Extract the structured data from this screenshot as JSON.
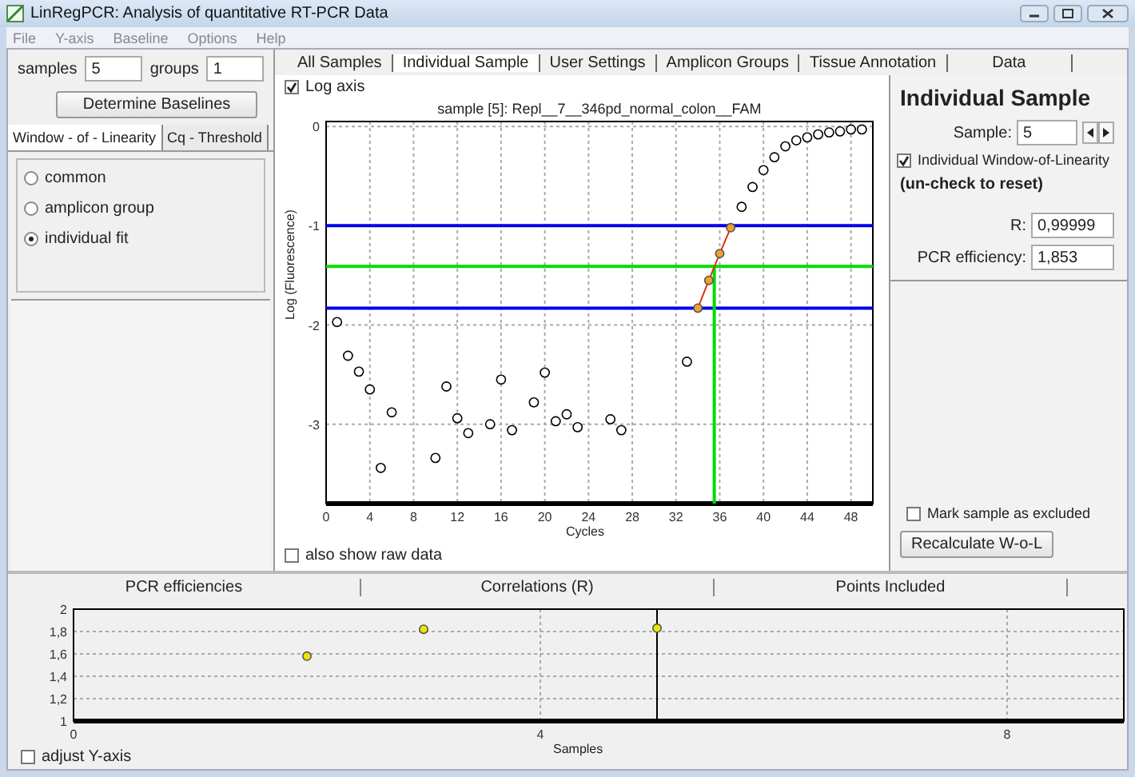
{
  "window": {
    "title": "LinRegPCR: Analysis of quantitative RT-PCR Data"
  },
  "menu": [
    "File",
    "Y-axis",
    "Baseline",
    "Options",
    "Help"
  ],
  "left_panel": {
    "samples": {
      "label": "samples",
      "value": "5"
    },
    "groups": {
      "label": "groups",
      "value": "1"
    },
    "determine_button": "Determine Baselines",
    "tabs": [
      {
        "label": "Window - of - Linearity",
        "selected": true
      },
      {
        "label": "Cq - Threshold",
        "selected": false
      }
    ],
    "options": [
      {
        "label": "common",
        "selected": false
      },
      {
        "label": "amplicon group",
        "selected": false
      },
      {
        "label": "individual fit",
        "selected": true
      }
    ]
  },
  "tabs": [
    {
      "label": "All Samples",
      "selected": false
    },
    {
      "label": "Individual Sample",
      "selected": true
    },
    {
      "label": "User Settings",
      "selected": false
    },
    {
      "label": "Amplicon Groups",
      "selected": false
    },
    {
      "label": "Tissue Annotation",
      "selected": false
    },
    {
      "label": "Data",
      "selected": false
    }
  ],
  "individual_sample": {
    "log_axis": {
      "label": "Log axis",
      "checked": true
    },
    "chart_data": {
      "type": "scatter",
      "title": "sample [5]: Repl__7__346pd_normal_colon__FAM",
      "xlabel": "Cycles",
      "ylabel": "Log (Fluorescence)",
      "x": [
        1,
        2,
        3,
        4,
        5,
        6,
        10,
        11,
        12,
        13,
        15,
        16,
        17,
        19,
        20,
        21,
        22,
        23,
        26,
        27,
        33,
        34,
        35,
        36,
        37,
        38,
        39,
        40,
        41,
        42,
        43,
        44,
        45,
        46,
        47,
        48,
        49
      ],
      "series": [
        {
          "type": "scatter",
          "color": "#000000",
          "values": [
            -1.97,
            -2.31,
            -2.47,
            -2.65,
            -3.44,
            -2.88,
            -3.34,
            -2.62,
            -2.94,
            -3.09,
            -3.0,
            -2.55,
            -3.06,
            -2.78,
            -2.48,
            -2.97,
            -2.9,
            -3.03,
            -2.95,
            -3.06,
            -2.37,
            null,
            null,
            null,
            null,
            -0.81,
            -0.61,
            -0.44,
            -0.31,
            -0.2,
            -0.14,
            -0.11,
            -0.08,
            -0.06,
            -0.05,
            -0.03,
            -0.03
          ]
        },
        {
          "type": "line",
          "marker": "o",
          "color": "#f0a030",
          "values": [
            null,
            null,
            null,
            null,
            null,
            null,
            null,
            null,
            null,
            null,
            null,
            null,
            null,
            null,
            null,
            null,
            null,
            null,
            null,
            null,
            null,
            -1.83,
            -1.55,
            -1.28,
            -1.02,
            null,
            null,
            null,
            null,
            null,
            null,
            null,
            null,
            null,
            null,
            null,
            null
          ]
        }
      ],
      "grid": true,
      "xlim": [
        0,
        50
      ],
      "ylim": [
        -3.8,
        0.05
      ],
      "xticks": [
        0,
        4,
        8,
        12,
        16,
        20,
        24,
        28,
        32,
        36,
        40,
        44,
        48
      ],
      "yticks": [
        0,
        -1,
        -2,
        -3
      ],
      "ref_lines": [
        {
          "axis": "y",
          "value": -1.0,
          "color": "#0000ee"
        },
        {
          "axis": "y",
          "value": -1.83,
          "color": "#0000ee"
        },
        {
          "axis": "y",
          "value": -1.41,
          "color": "#00dd00"
        },
        {
          "axis": "x",
          "value": 35.5,
          "color": "#00dd00"
        }
      ]
    },
    "raw_data": {
      "label": "also show raw data",
      "checked": false
    }
  },
  "side_panel": {
    "title": "Individual Sample",
    "sample": {
      "label": "Sample:",
      "value": "5"
    },
    "individual_wol": {
      "label": "Individual Window-of-Linearity",
      "checked": true
    },
    "hint": "(un-check to reset)",
    "r": {
      "label": "R:",
      "value": "0,99999"
    },
    "efficiency": {
      "label": "PCR efficiency:",
      "value": "1,853"
    },
    "exclude": {
      "label": "Mark sample as excluded",
      "checked": false
    },
    "recalculate_button": "Recalculate W-o-L"
  },
  "bottom": {
    "tabs": [
      "PCR efficiencies",
      "Correlations (R)",
      "Points Included"
    ],
    "chart_data": {
      "type": "scatter",
      "xlabel": "Samples",
      "x": [
        2,
        3,
        5
      ],
      "series": [
        {
          "type": "scatter",
          "color": "#e8e800",
          "values": [
            1.58,
            1.82,
            1.83
          ]
        }
      ],
      "grid": true,
      "xlim": [
        0,
        9
      ],
      "ylim": [
        1,
        2
      ],
      "xticks": [
        0,
        4,
        8
      ],
      "yticks": [
        {
          "value": 1,
          "label": "1"
        },
        {
          "value": 1.2,
          "label": "1,2"
        },
        {
          "value": 1.4,
          "label": "1,4"
        },
        {
          "value": 1.6,
          "label": "1,6"
        },
        {
          "value": 1.8,
          "label": "1,8"
        },
        {
          "value": 2,
          "label": "2"
        }
      ],
      "ref_lines": [
        {
          "axis": "x",
          "value": 5,
          "color": "#000000"
        }
      ]
    },
    "adjust_y": {
      "label": "adjust Y-axis",
      "checked": false
    }
  }
}
